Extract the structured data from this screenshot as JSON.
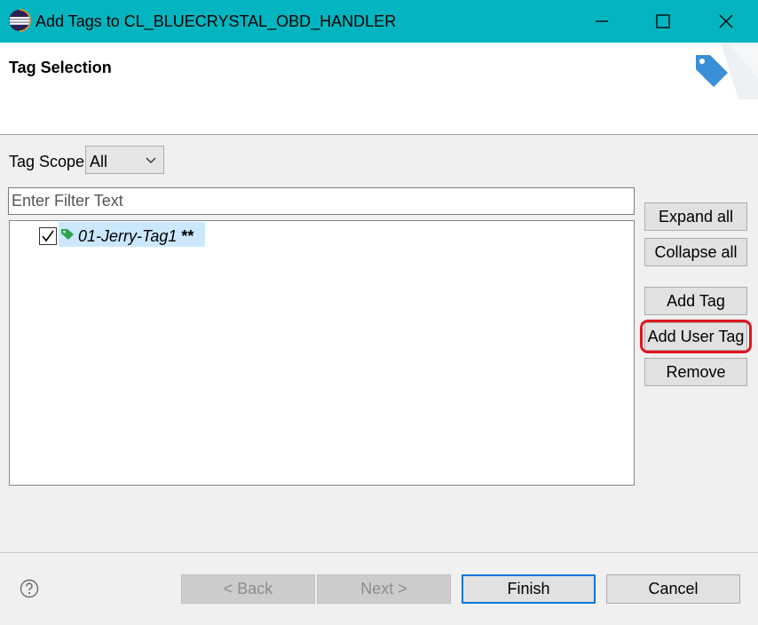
{
  "window": {
    "title": "Add Tags to CL_BLUECRYSTAL_OBD_HANDLER"
  },
  "header": {
    "title": "Tag Selection"
  },
  "scope": {
    "label": "Tag Scope",
    "selected": "All"
  },
  "filter": {
    "placeholder": "Enter Filter Text",
    "value": ""
  },
  "tree": {
    "items": [
      {
        "label": "01-Jerry-Tag1",
        "suffix": " **",
        "checked": true
      }
    ]
  },
  "side_buttons": {
    "expand_all": "Expand all",
    "collapse_all": "Collapse all",
    "add_tag": "Add Tag",
    "add_user_tag": "Add User Tag",
    "remove": "Remove"
  },
  "footer": {
    "back": "< Back",
    "next": "Next >",
    "finish": "Finish",
    "cancel": "Cancel"
  },
  "colors": {
    "titlebar": "#03b5c0",
    "highlight": "#e0141c",
    "tag_icon": "#2aa34a",
    "banner_icon": "#3a8fd6"
  },
  "icons": {
    "app": "eclipse-icon",
    "minimize": "minimize-icon",
    "maximize": "maximize-icon",
    "close": "close-icon",
    "banner": "tag-icon",
    "tree_item": "tag-icon",
    "help": "help-icon",
    "dropdown": "chevron-down-icon"
  }
}
